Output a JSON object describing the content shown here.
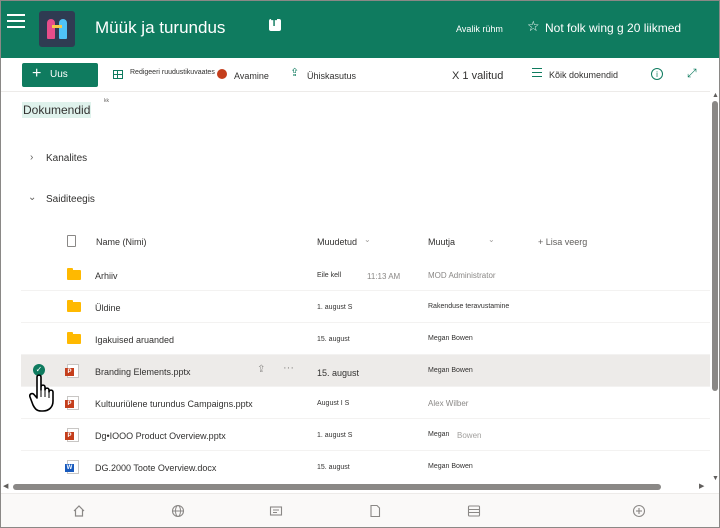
{
  "header": {
    "site_title": "Müük ja turundus",
    "group_type": "Avalik rühm",
    "members": "Not folk wing g 20 liikmed",
    "accent_color": "#0f7b5f"
  },
  "cmdbar": {
    "new_label": "Uus",
    "edit_grid_label": "Redigeeri ruudustikuvaates",
    "open_label": "Avamine",
    "share_label": "Ühiskasutus",
    "selected_count": "X 1 valitud",
    "view_label": "Kõik dokumendid"
  },
  "breadcrumb": {
    "title": "Dokumendid",
    "tag": "kk"
  },
  "sections": {
    "channels": "Kanalites",
    "site": "Saiditeegis"
  },
  "columns": {
    "name": "Name (Nimi)",
    "modified": "Muudetud",
    "author": "Muutja",
    "add_column": "+ Lisa veerg"
  },
  "rows": [
    {
      "type": "folder",
      "name": "Arhiiv",
      "modified": "Eile kell",
      "modified_time": "11:13 AM",
      "author": "MOD Administrator",
      "author2": "",
      "author_dim": true
    },
    {
      "type": "folder",
      "name": "Üldine",
      "modified": "1. august S",
      "modified_time": "",
      "author": "Rakenduse teravustamine",
      "author2": "",
      "author_dim": false
    },
    {
      "type": "folder",
      "name": "Igakuised aruanded",
      "modified": "15. august",
      "modified_time": "",
      "author": "Megan Bowen",
      "author2": "",
      "author_dim": false
    },
    {
      "type": "ppt",
      "name": "Branding Elements.pptx",
      "modified": "15. august",
      "modified_time": "",
      "author": "Megan Bowen",
      "author2": "",
      "author_dim": false,
      "selected": true
    },
    {
      "type": "ppt",
      "name": "Kultuuriülene turundus Campaigns.pptx",
      "modified": "August I S",
      "modified_time": "",
      "author": "Alex Wilber",
      "author2": "",
      "author_dim": true
    },
    {
      "type": "ppt",
      "name": "Dg•IOOO Product Overview.pptx",
      "modified": "1. august S",
      "modified_time": "",
      "author": "Megan",
      "author2": "Bowen",
      "author_dim": false
    },
    {
      "type": "word",
      "name": "DG.2000 Toote Overview.docx",
      "modified": "15. august",
      "modified_time": "",
      "author": "Megan Bowen",
      "author2": "",
      "author_dim": false
    }
  ],
  "icons": {
    "menu": "hamburger-icon",
    "check": "✓",
    "share": "⇪",
    "more": "···",
    "star": "☆",
    "expand": "⤢",
    "info": "i"
  }
}
